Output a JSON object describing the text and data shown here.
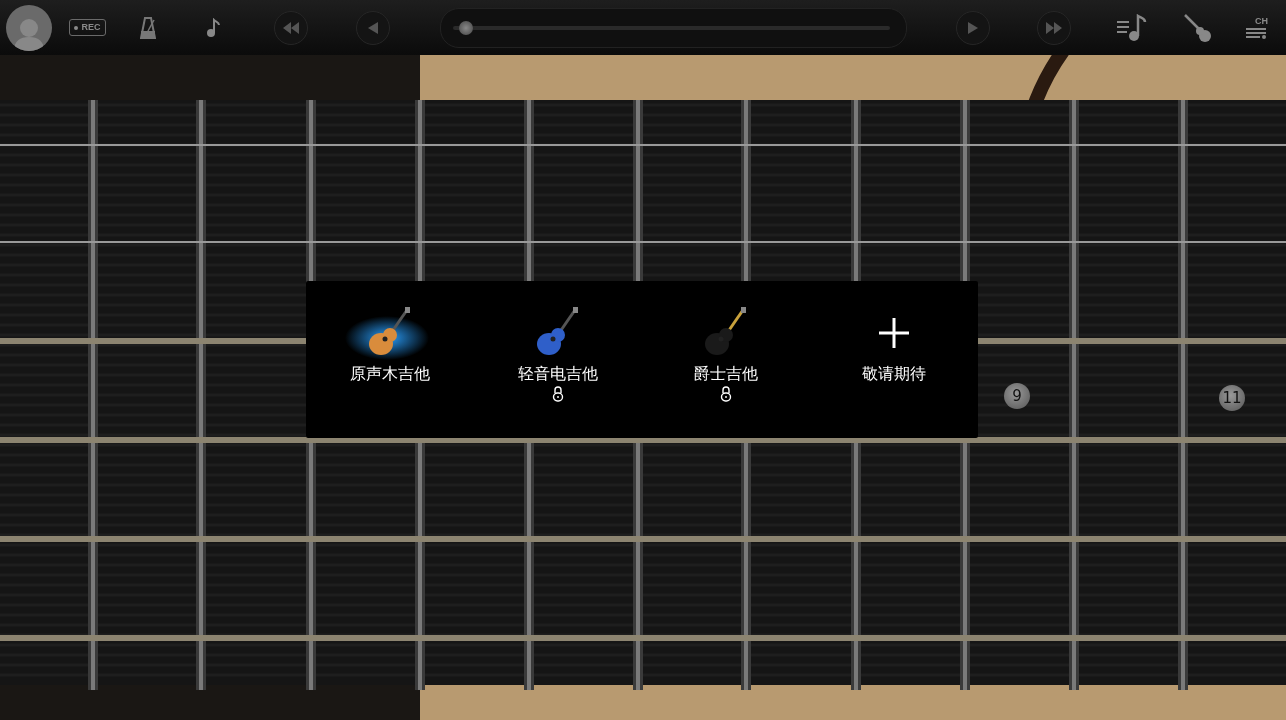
{
  "toolbar": {
    "rec_label": "REC",
    "progress": {
      "level": 0.03
    },
    "chord_label": "CH"
  },
  "fret_markers": [
    {
      "label": "9"
    },
    {
      "label": "11"
    }
  ],
  "instrument_menu": {
    "items": [
      {
        "kind": "acoustic",
        "label": "原声木吉他",
        "selected": true,
        "locked": false
      },
      {
        "kind": "bass",
        "label": "轻音电吉他",
        "selected": false,
        "locked": true
      },
      {
        "kind": "jazz",
        "label": "爵士吉他",
        "selected": false,
        "locked": true
      },
      {
        "kind": "more",
        "label": "敬请期待",
        "selected": false,
        "locked": false
      }
    ]
  }
}
